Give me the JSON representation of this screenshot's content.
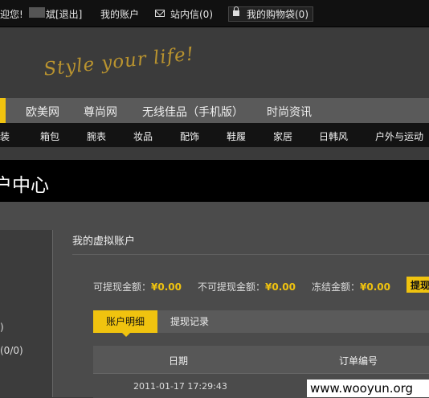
{
  "topbar": {
    "welcome": "迎您!",
    "name_suffix": "斌[退出]",
    "my_account": "我的账户",
    "messages": "站内信(0)",
    "cart": "我的购物袋(0)"
  },
  "banner": {
    "logo_text": "Style your life!"
  },
  "nav1": {
    "items": [
      "欧美网",
      "尊尚网",
      "无线佳品（手机版）",
      "时尚资讯"
    ]
  },
  "nav2": {
    "items": [
      "装",
      "箱包",
      "腕表",
      "妆品",
      "配饰",
      "鞋履",
      "家居",
      "日韩风",
      "户外与运动"
    ]
  },
  "page_title": "户中心",
  "sidebar": {
    "items": [
      ")",
      "(0/0)"
    ]
  },
  "main": {
    "title": "我的虚拟账户",
    "amounts": [
      {
        "label": "可提现金额：",
        "value": "¥0.00"
      },
      {
        "label": "不可提现金额：",
        "value": "¥0.00"
      },
      {
        "label": "冻结金额：",
        "value": "¥0.00"
      }
    ],
    "withdraw_button": "提现",
    "tabs": [
      "账户明细",
      "提现记录"
    ],
    "table": {
      "headers": [
        "日期",
        "订单编号"
      ],
      "rows": [
        {
          "date": "2011-01-17 17:29:43",
          "order": ""
        }
      ]
    }
  },
  "watermark": "www.wooyun.org",
  "colors": {
    "accent": "#f0c30f"
  }
}
